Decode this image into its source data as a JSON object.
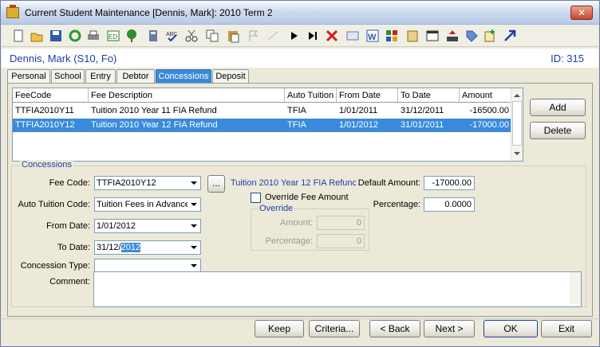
{
  "window": {
    "title": "Current Student Maintenance  [Dennis, Mark]:  2010 Term 2",
    "close_label": "✕"
  },
  "toolbar": {
    "icons": [
      "new-icon",
      "open-icon",
      "save-icon",
      "refresh-icon",
      "print-icon",
      "edit-icon",
      "tree-icon",
      "calculator-icon",
      "spellcheck-icon",
      "cut-icon",
      "copy-icon",
      "paste-icon",
      "flag-icon",
      "line-icon",
      "play-icon",
      "next-end-icon",
      "delete-icon",
      "card-icon",
      "word-icon",
      "grid-icon",
      "clipboard-icon",
      "calendar-icon",
      "upload-icon",
      "tag-icon",
      "add-note-icon",
      "arrow-icon"
    ]
  },
  "student": {
    "name": "Dennis, Mark (S10, Fo)",
    "id": "ID: 315"
  },
  "tabs": [
    "Personal",
    "School",
    "Entry",
    "Debtor",
    "Concessions",
    "Deposit"
  ],
  "grid": {
    "headers": [
      "FeeCode",
      "Fee Description",
      "Auto Tuition",
      "From Date",
      "To Date",
      "Amount"
    ],
    "rows": [
      {
        "code": "TTFIA2010Y11",
        "desc": "Tuition 2010 Year 11 FIA Refund",
        "auto": "TFIA",
        "from": "1/01/2011",
        "to": "31/12/2011",
        "amount": "-16500.00"
      },
      {
        "code": "TTFIA2010Y12",
        "desc": "Tuition 2010 Year 12 FIA Refund",
        "auto": "TFIA",
        "from": "1/01/2012",
        "to": "31/01/2011",
        "amount": "-17000.00"
      }
    ]
  },
  "side_buttons": {
    "add": "Add",
    "delete": "Delete"
  },
  "concessions": {
    "group_title": "Concessions",
    "fee_code_label": "Fee Code:",
    "fee_code_value": "TTFIA2010Y12",
    "browse_label": "...",
    "fee_desc": "Tuition 2010 Year 12 FIA Refunc",
    "default_amount_label": "Default Amount:",
    "default_amount_value": "-17000.00",
    "auto_tuition_label": "Auto Tuition Code:",
    "auto_tuition_value": "Tuition Fees in Advance",
    "override_fee_label": "Override Fee Amount",
    "percentage_label": "Percentage:",
    "percentage_value": "0.0000",
    "from_date_label": "From Date:",
    "from_date_value": "1/01/2012",
    "override_title": "Override",
    "ov_amount_label": "Amount:",
    "ov_amount_value": "0",
    "ov_percentage_label": "Percentage:",
    "ov_percentage_value": "0",
    "to_date_label": "To Date:",
    "to_date_prefix": "31/12/",
    "to_date_selected": "2012",
    "concession_type_label": "Concession Type:",
    "concession_type_value": "",
    "comment_label": "Comment:"
  },
  "footer": {
    "keep": "Keep",
    "criteria": "Criteria...",
    "back": "< Back",
    "next": "Next >",
    "ok": "OK",
    "exit": "Exit"
  }
}
